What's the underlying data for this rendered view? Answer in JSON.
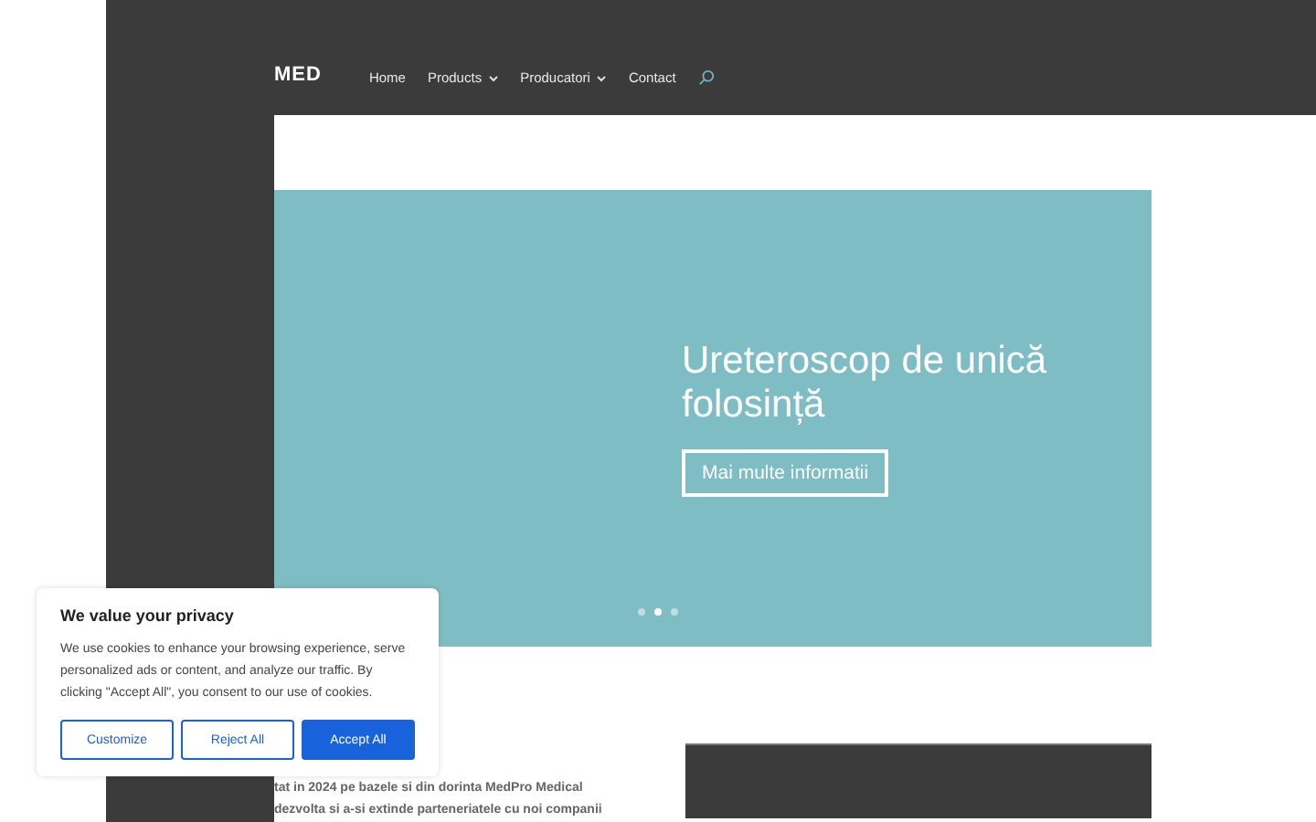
{
  "header": {
    "logo": "MED",
    "nav": [
      {
        "label": "Home",
        "dropdown": false
      },
      {
        "label": "Products",
        "dropdown": true
      },
      {
        "label": "Producatori",
        "dropdown": true
      },
      {
        "label": "Contact",
        "dropdown": false
      }
    ]
  },
  "slider": {
    "title": "Ureteroscop de unică folosință",
    "button": "Mai multe informatii",
    "dots": [
      {
        "selected": false
      },
      {
        "selected": true
      },
      {
        "selected": false
      }
    ]
  },
  "intro": {
    "lines": [
      "tat in 2024 pe bazele si din dorinta MedPro Medical",
      "dezvolta si a-si extinde parteneriatele cu noi companii"
    ]
  },
  "cookie_banner": {
    "title": "We value your privacy",
    "text": "We use cookies to enhance your browsing experience, serve personalized ads or content, and analyze our traffic. By clicking \"Accept All\", you consent to our use of cookies.",
    "buttons": [
      {
        "label": "Customize",
        "kind": "outline"
      },
      {
        "label": "Reject All",
        "kind": "outline"
      },
      {
        "label": "Accept All",
        "kind": "primary"
      }
    ]
  }
}
